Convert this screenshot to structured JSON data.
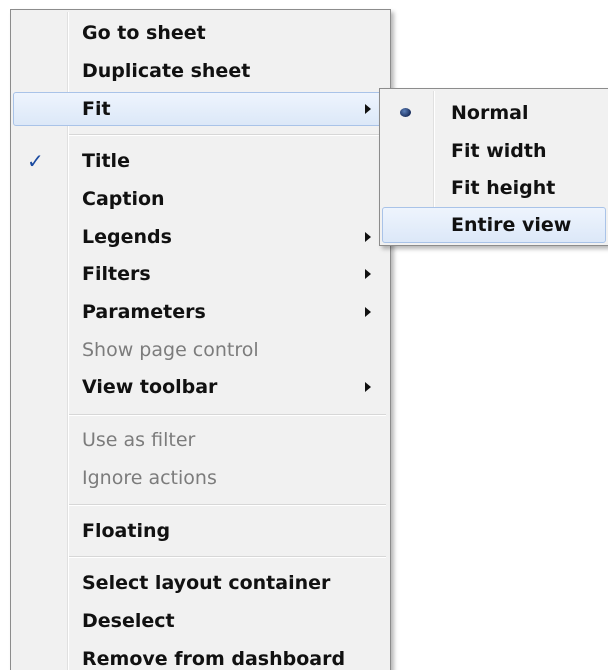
{
  "menu": {
    "items": [
      {
        "label": "Go to sheet"
      },
      {
        "label": "Duplicate sheet"
      },
      {
        "label": "Fit"
      },
      {
        "label": "Title"
      },
      {
        "label": "Caption"
      },
      {
        "label": "Legends"
      },
      {
        "label": "Filters"
      },
      {
        "label": "Parameters"
      },
      {
        "label": "Show page control"
      },
      {
        "label": "View toolbar"
      },
      {
        "label": "Use as filter"
      },
      {
        "label": "Ignore actions"
      },
      {
        "label": "Floating"
      },
      {
        "label": "Select layout container"
      },
      {
        "label": "Deselect"
      },
      {
        "label": "Remove from dashboard"
      }
    ],
    "check_glyph": "✓"
  },
  "fit_submenu": {
    "items": [
      {
        "label": "Normal"
      },
      {
        "label": "Fit width"
      },
      {
        "label": "Fit height"
      },
      {
        "label": "Entire view"
      }
    ]
  },
  "icons": {
    "submenu_arrow": "submenu-arrow-icon",
    "checkmark": "checkmark-icon",
    "radio": "radio-dot-icon"
  },
  "colors": {
    "menu_bg": "#f1f1f1",
    "highlight_border": "#a9c3e8",
    "check": "#1a4aa0",
    "disabled_text": "#7c7c7c"
  }
}
